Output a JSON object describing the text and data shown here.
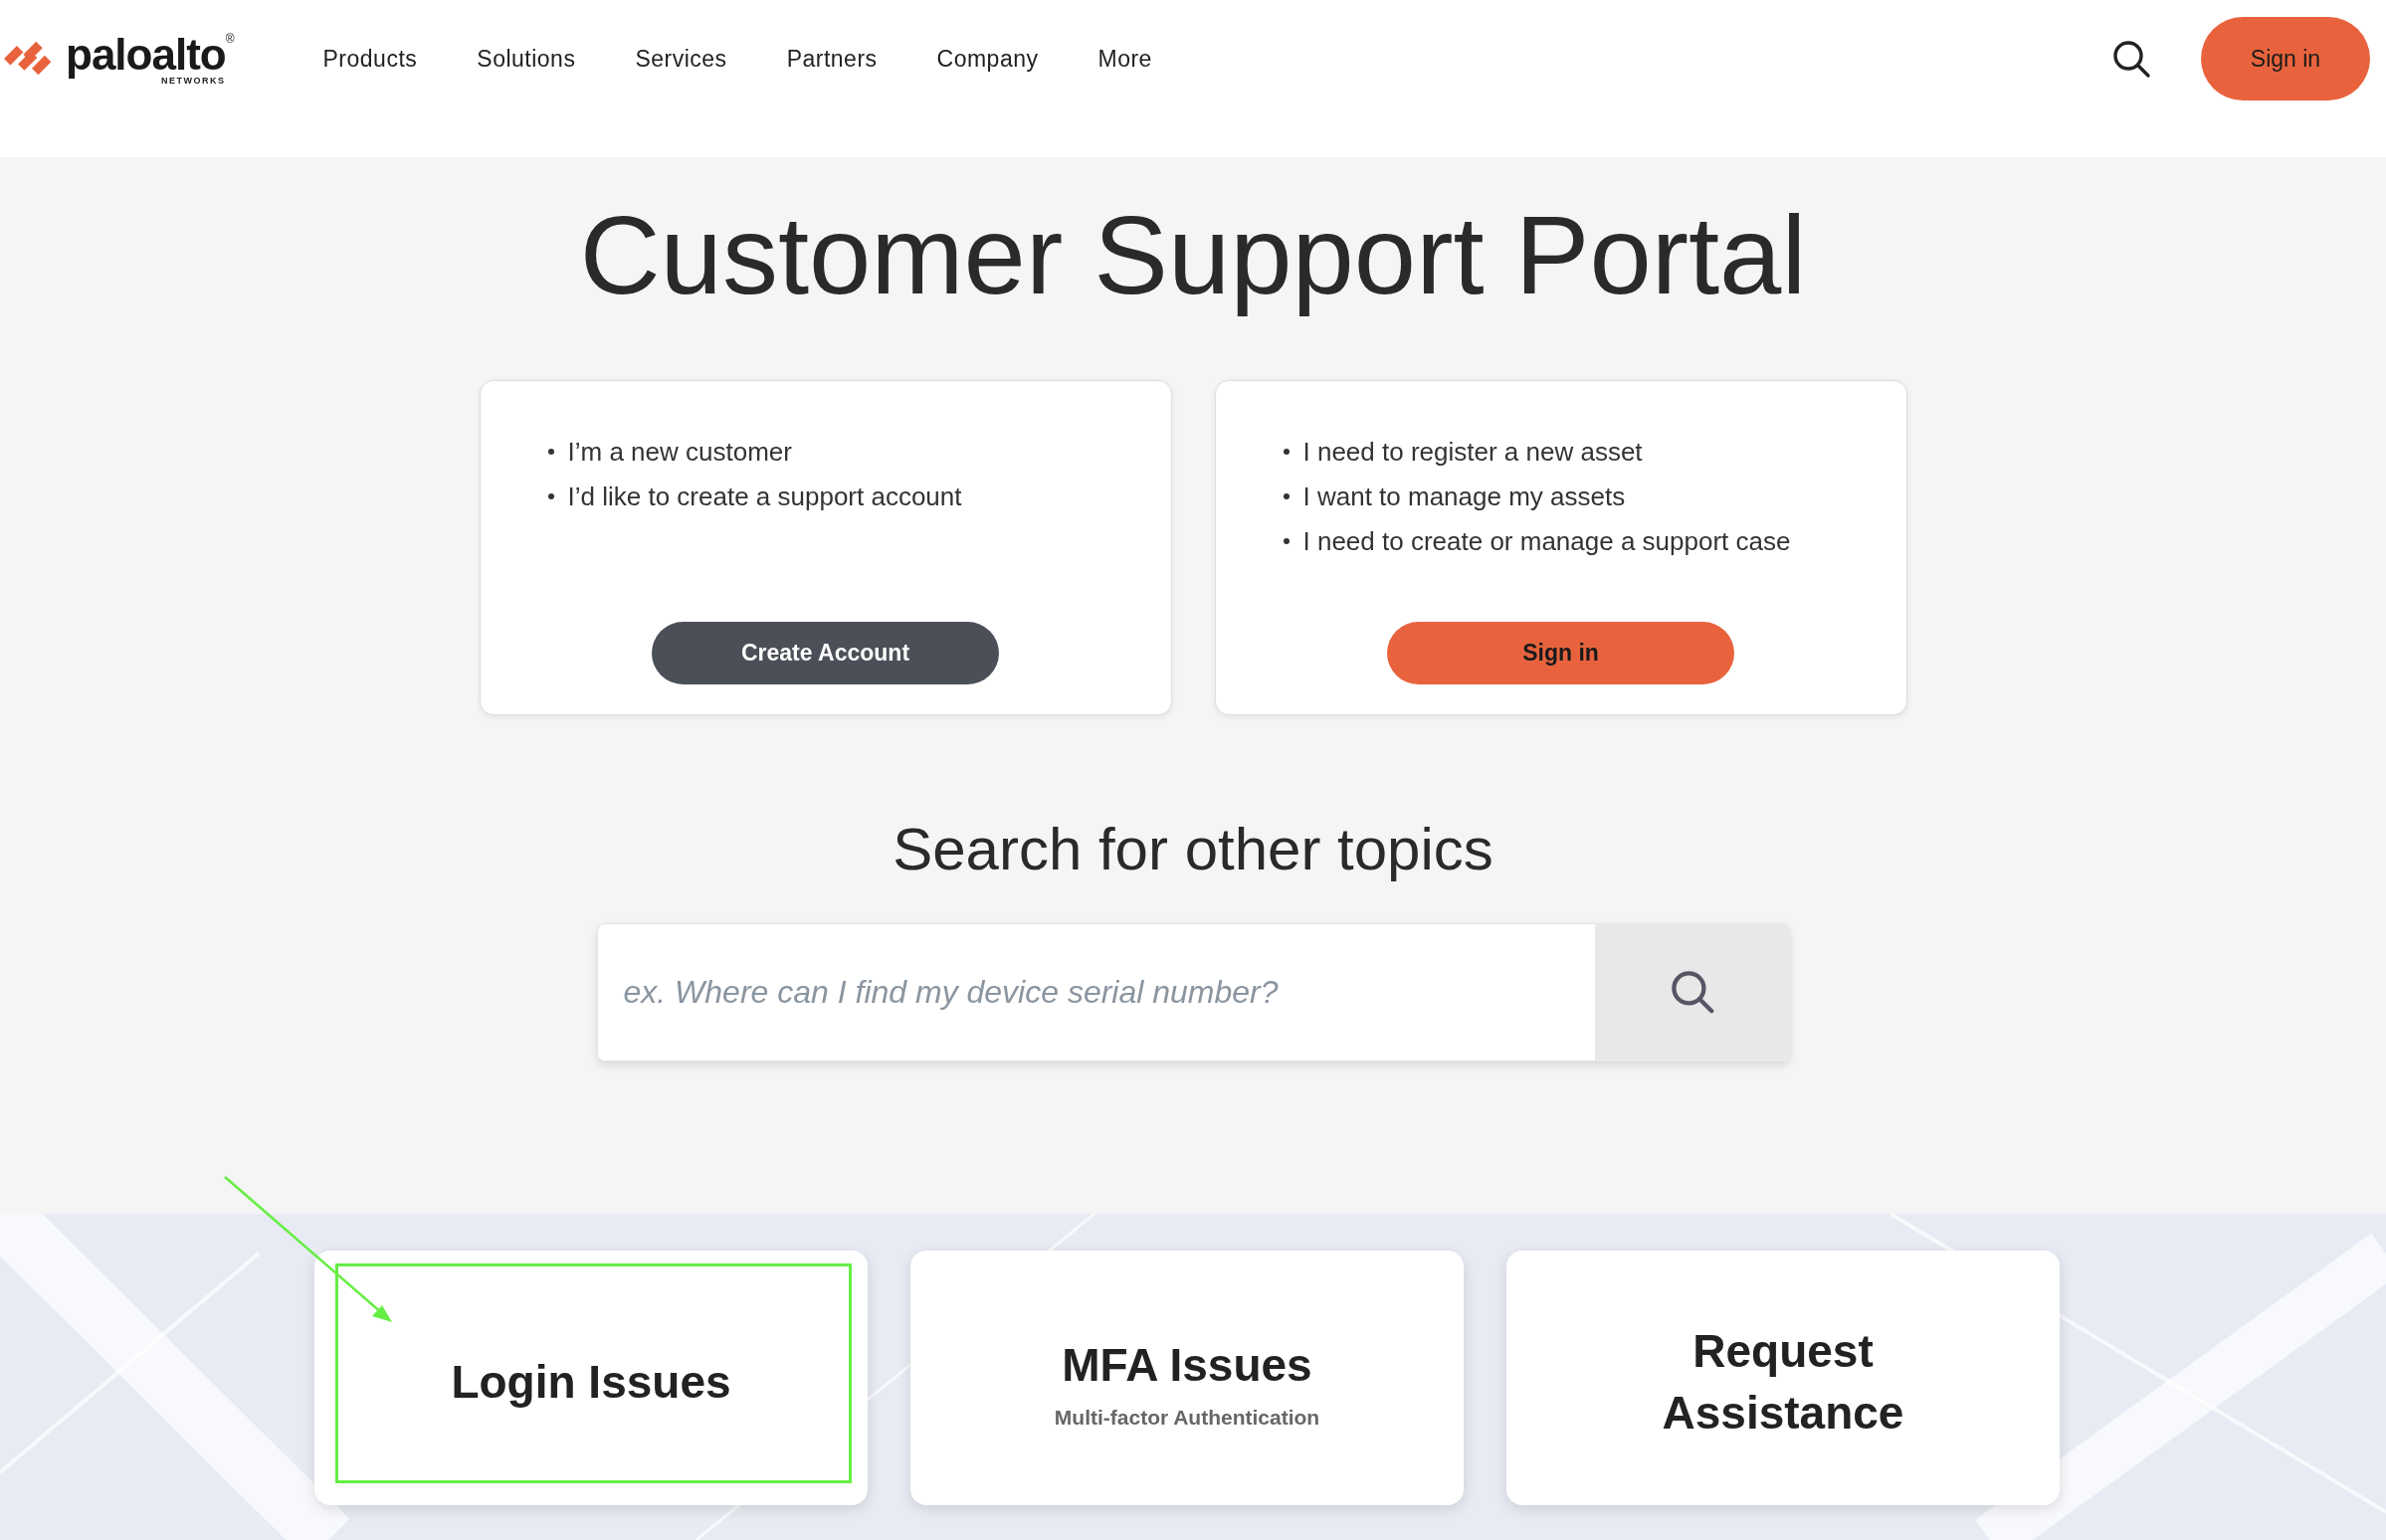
{
  "header": {
    "logo": {
      "wordmark": "paloalto",
      "registered": "®",
      "subtitle": "NETWORKS"
    },
    "nav": [
      {
        "label": "Products"
      },
      {
        "label": "Solutions"
      },
      {
        "label": "Services"
      },
      {
        "label": "Partners"
      },
      {
        "label": "Company"
      },
      {
        "label": "More"
      }
    ],
    "sign_in": "Sign in"
  },
  "title": "Customer Support Portal",
  "cards": [
    {
      "bullets": [
        "I’m a new customer",
        "I’d like to create a support account"
      ],
      "button": {
        "label": "Create Account",
        "kind": "dark"
      }
    },
    {
      "bullets": [
        "I need to register a new asset",
        "I want to manage my assets",
        "I need to create or manage a support case"
      ],
      "button": {
        "label": "Sign in",
        "kind": "accent"
      }
    }
  ],
  "search": {
    "heading": "Search for other topics",
    "placeholder": "ex. Where can I find my device serial number?"
  },
  "topics": [
    {
      "title": "Login Issues",
      "highlighted": true
    },
    {
      "title": "MFA Issues",
      "subtitle": "Multi-factor Authentication",
      "highlighted": false
    },
    {
      "title": "Request Assistance",
      "highlighted": false
    }
  ]
}
